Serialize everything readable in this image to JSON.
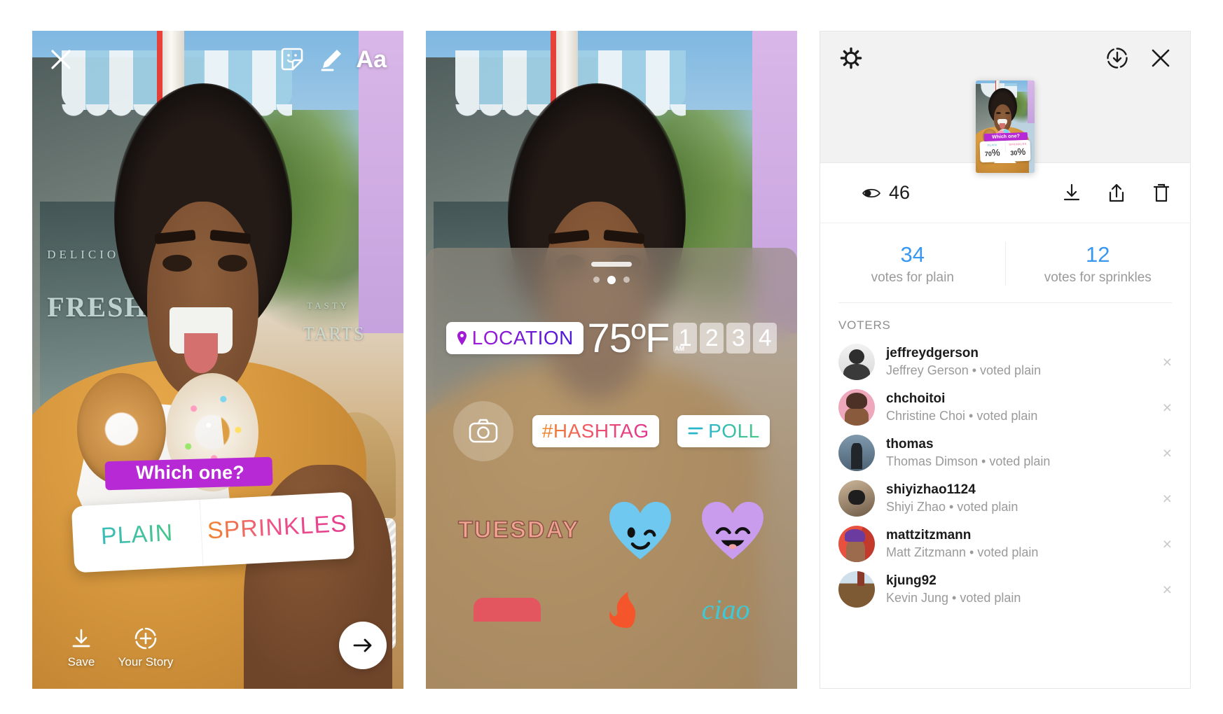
{
  "left_panel": {
    "name": "story-composer",
    "toolbar": {
      "close_label": "×",
      "sticker_icon": "sticker-face-icon",
      "draw_icon": "marker-pen-icon",
      "text_label": "Aa"
    },
    "scene_text": {
      "sign_delicious": "DELICIO",
      "sign_fresh_pies": "FRESH PIES",
      "sign_tasty": "TASTY",
      "sign_tarts": "TARTS"
    },
    "poll_sticker": {
      "question": "Which one?",
      "option_left": "PLAIN",
      "option_right": "SPRINKLES"
    },
    "bottom_bar": {
      "save_label": "Save",
      "your_story_label": "Your Story",
      "next_icon": "arrow-right-icon"
    }
  },
  "middle_panel": {
    "name": "sticker-tray",
    "dots": [
      "",
      "",
      ""
    ],
    "active_dot_index": 1,
    "stickers": {
      "location": "LOCATION",
      "temperature": "75ºF",
      "clock_am": "AM",
      "clock_digits": [
        "1",
        "2",
        "3",
        "4"
      ],
      "camera": "camera-icon",
      "hashtag": "#HASHTAG",
      "poll": "POLL",
      "tuesday": "TUESDAY",
      "heart_wink": "winking-heart-sticker",
      "heart_smile": "smiling-heart-sticker"
    }
  },
  "right_panel": {
    "name": "story-insights",
    "header": {
      "gear_icon": "gear-icon",
      "download_circle_icon": "download-circle-icon",
      "close_icon": "close-icon"
    },
    "thumbnail": {
      "which_one": "Which one?",
      "left_label": "PLAIN",
      "left_pct": "70",
      "left_pct_sym": "%",
      "right_label": "SPRINKLES",
      "right_pct": "30",
      "right_pct_sym": "%"
    },
    "actions": {
      "views_count": "46",
      "views_icon": "eye-icon",
      "download_icon": "download-icon",
      "share_icon": "share-up-icon",
      "delete_icon": "trash-icon"
    },
    "votes": [
      {
        "count": "34",
        "label": "votes for plain"
      },
      {
        "count": "12",
        "label": "votes for sprinkles"
      }
    ],
    "voters_title": "VOTERS",
    "voters": [
      {
        "username": "jeffreydgerson",
        "subtitle": "Jeffrey Gerson • voted plain",
        "remove": "×"
      },
      {
        "username": "chchoitoi",
        "subtitle": "Christine Choi • voted plain",
        "remove": "×"
      },
      {
        "username": "thomas",
        "subtitle": "Thomas Dimson • voted plain",
        "remove": "×"
      },
      {
        "username": "shiyizhao1124",
        "subtitle": "Shiyi Zhao • voted plain",
        "remove": "×"
      },
      {
        "username": "mattzitzmann",
        "subtitle": "Matt Zitzmann • voted plain",
        "remove": "×"
      },
      {
        "username": "kjung92",
        "subtitle": "Kevin Jung • voted plain",
        "remove": "×"
      }
    ],
    "colors": {
      "accent_blue": "#3897f0",
      "muted_gray": "#9a9a9a",
      "header_bg": "#f2f2f2"
    }
  }
}
